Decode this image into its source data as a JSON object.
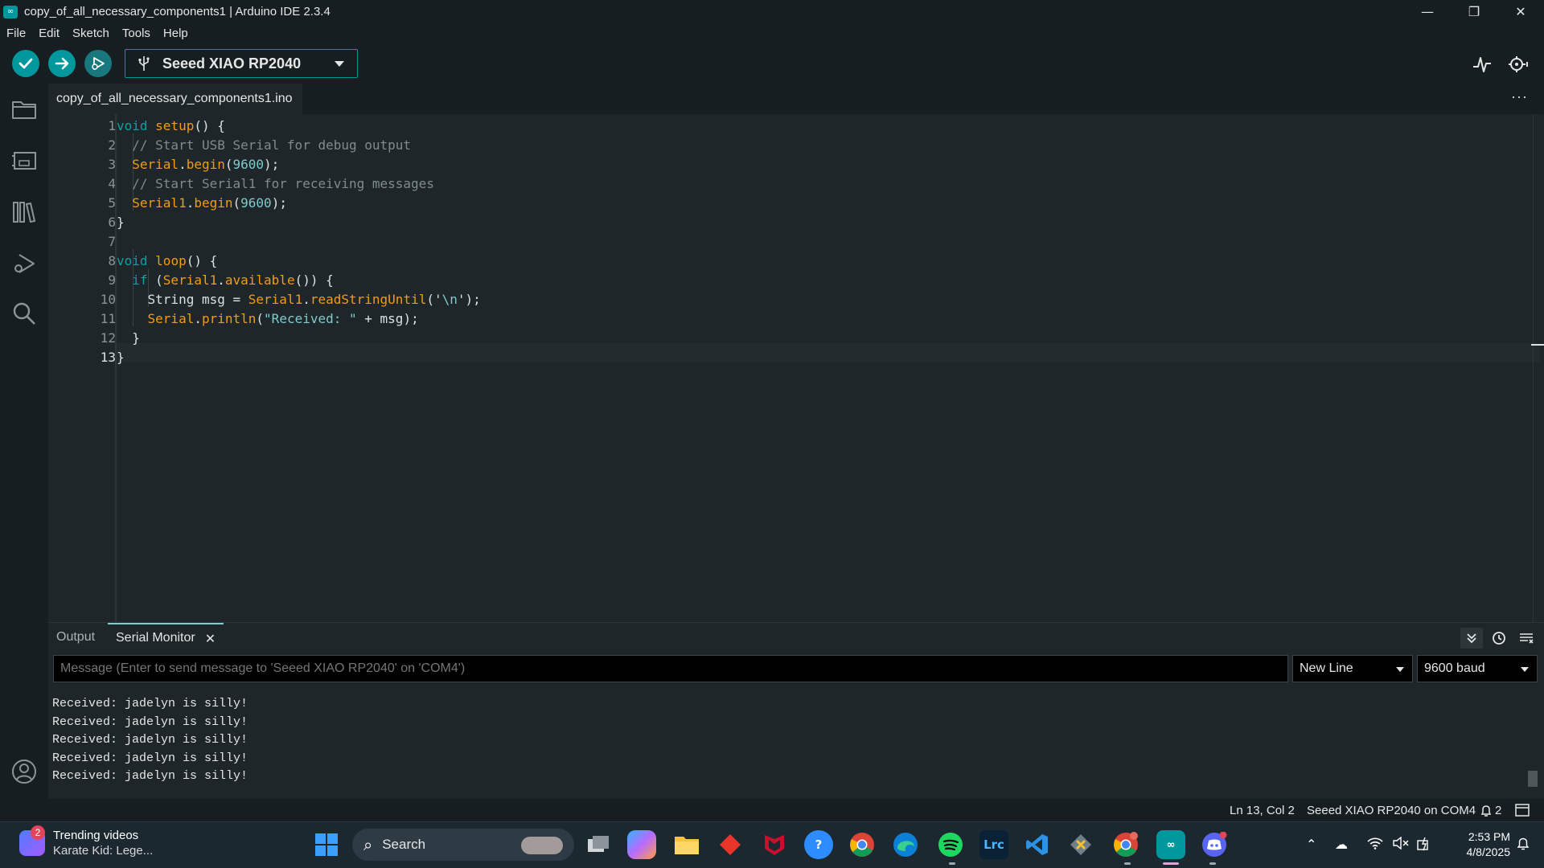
{
  "window": {
    "title": "copy_of_all_necessary_components1 | Arduino IDE 2.3.4",
    "minimize": "—",
    "restore": "❐",
    "close": "✕"
  },
  "menu": [
    "File",
    "Edit",
    "Sketch",
    "Tools",
    "Help"
  ],
  "toolbar": {
    "board": "Seeed XIAO RP2040"
  },
  "editor": {
    "file_tab": "copy_of_all_necessary_components1.ino",
    "more": "···",
    "line_numbers": [
      "1",
      "2",
      "3",
      "4",
      "5",
      "6",
      "7",
      "8",
      "9",
      "10",
      "11",
      "12",
      "13"
    ],
    "lines": [
      [
        {
          "t": "void",
          "c": "kw"
        },
        {
          "t": " "
        },
        {
          "t": "setup",
          "c": "fn"
        },
        {
          "t": "() {"
        }
      ],
      [
        {
          "t": "  "
        },
        {
          "t": "// Start USB Serial for debug output",
          "c": "cm"
        }
      ],
      [
        {
          "t": "  "
        },
        {
          "t": "Serial",
          "c": "fn"
        },
        {
          "t": "."
        },
        {
          "t": "begin",
          "c": "fn"
        },
        {
          "t": "("
        },
        {
          "t": "9600",
          "c": "num"
        },
        {
          "t": ");"
        }
      ],
      [
        {
          "t": "  "
        },
        {
          "t": "// Start Serial1 for receiving messages",
          "c": "cm"
        }
      ],
      [
        {
          "t": "  "
        },
        {
          "t": "Serial1",
          "c": "fn"
        },
        {
          "t": "."
        },
        {
          "t": "begin",
          "c": "fn"
        },
        {
          "t": "("
        },
        {
          "t": "9600",
          "c": "num"
        },
        {
          "t": ");"
        }
      ],
      [
        {
          "t": "}"
        }
      ],
      [
        {
          "t": ""
        }
      ],
      [
        {
          "t": "void",
          "c": "kw"
        },
        {
          "t": " "
        },
        {
          "t": "loop",
          "c": "fn"
        },
        {
          "t": "() {"
        }
      ],
      [
        {
          "t": "  "
        },
        {
          "t": "if",
          "c": "kw"
        },
        {
          "t": " ("
        },
        {
          "t": "Serial1",
          "c": "fn"
        },
        {
          "t": "."
        },
        {
          "t": "available",
          "c": "fn"
        },
        {
          "t": "()) {"
        }
      ],
      [
        {
          "t": "    String msg = "
        },
        {
          "t": "Serial1",
          "c": "fn"
        },
        {
          "t": "."
        },
        {
          "t": "readStringUntil",
          "c": "fn"
        },
        {
          "t": "('"
        },
        {
          "t": "\\n",
          "c": "str"
        },
        {
          "t": "');"
        }
      ],
      [
        {
          "t": "    "
        },
        {
          "t": "Serial",
          "c": "fn"
        },
        {
          "t": "."
        },
        {
          "t": "println",
          "c": "fn"
        },
        {
          "t": "("
        },
        {
          "t": "\"Received: \"",
          "c": "str"
        },
        {
          "t": " + msg);"
        }
      ],
      [
        {
          "t": "  }"
        }
      ],
      [
        {
          "t": "}"
        }
      ]
    ]
  },
  "panel": {
    "tab_output": "Output",
    "tab_serial": "Serial Monitor",
    "tab_close": "✕",
    "message_placeholder": "Message (Enter to send message to 'Seeed XIAO RP2040' on 'COM4')",
    "line_ending": "New Line",
    "baud": "9600 baud",
    "output_lines": [
      "Received: jadelyn is silly!",
      "Received: jadelyn is silly!",
      "Received: jadelyn is silly!",
      "Received: jadelyn is silly!",
      "Received: jadelyn is silly!"
    ]
  },
  "status": {
    "position": "Ln 13, Col 2",
    "board_port": "Seeed XIAO RP2040 on COM4",
    "notifications": "2"
  },
  "taskbar": {
    "news_badge": "2",
    "news_title": "Trending videos",
    "news_sub": "Karate Kid: Lege...",
    "search_label": "Search",
    "time": "2:53 PM",
    "date": "4/8/2025",
    "lrc_label": "Lrc"
  },
  "colors": {
    "accent": "#00979d",
    "background": "#171e21",
    "editor_background": "#1e2629"
  }
}
